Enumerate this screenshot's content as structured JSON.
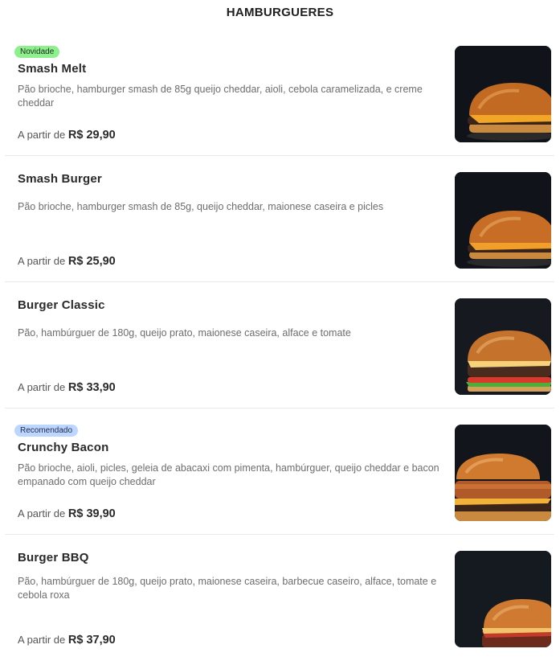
{
  "section": {
    "title": "HAMBURGUERES"
  },
  "price_prefix": "A partir de",
  "items": [
    {
      "badge": "Novidade",
      "name": "Smash Melt",
      "description": "Pão brioche, hamburger smash de 85g queijo cheddar, aioli, cebola caramelizada, e creme cheddar",
      "price": "R$ 29,90"
    },
    {
      "name": "Smash Burger",
      "description": "Pão brioche, hamburger smash de 85g, queijo cheddar, maionese caseira e picles",
      "price": "R$ 25,90"
    },
    {
      "name": "Burger Classic",
      "description": "Pão, hambúrguer de 180g, queijo prato, maionese caseira, alface e tomate",
      "price": "R$ 33,90"
    },
    {
      "badge": "Recomendado",
      "name": "Crunchy Bacon",
      "description": "Pão brioche, aioli, picles, geleia de abacaxi com pimenta, hambúrguer, queijo cheddar e bacon empanado com queijo cheddar",
      "price": "R$ 39,90"
    },
    {
      "name": "Burger BBQ",
      "description": "Pão, hambúrguer de 180g, queijo prato, maionese caseira, barbecue caseiro, alface, tomate e cebola roxa",
      "price": "R$ 37,90"
    }
  ],
  "colors": {
    "badge_new": "#8ef08d",
    "badge_recommended": "#bcd6ff",
    "photo_background": "#0f1216"
  }
}
